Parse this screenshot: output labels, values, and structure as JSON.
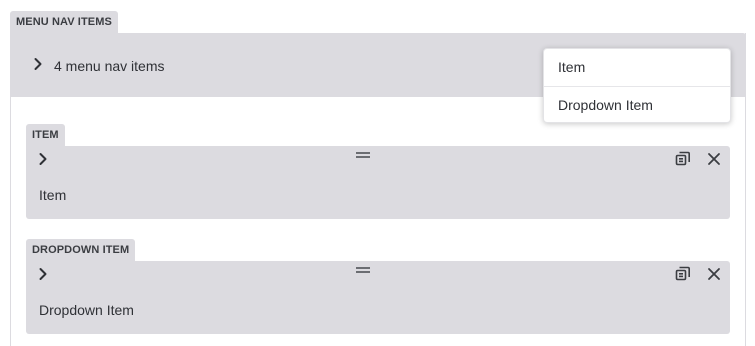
{
  "outer": {
    "label": "MENU NAV ITEMS",
    "summary": "4 menu nav items"
  },
  "blocks": [
    {
      "label": "ITEM",
      "title": "Item"
    },
    {
      "label": "DROPDOWN ITEM",
      "title": "Dropdown Item"
    }
  ],
  "dropdown": {
    "options": [
      "Item",
      "Dropdown Item"
    ]
  },
  "icons": {
    "expand": "chevron-right-icon",
    "drag": "drag-handle-icon",
    "duplicate": "copy-icon",
    "remove": "close-icon"
  },
  "colors": {
    "panel": "#dcdbe0",
    "text": "#2f3136",
    "icon": "#3b3d42"
  }
}
